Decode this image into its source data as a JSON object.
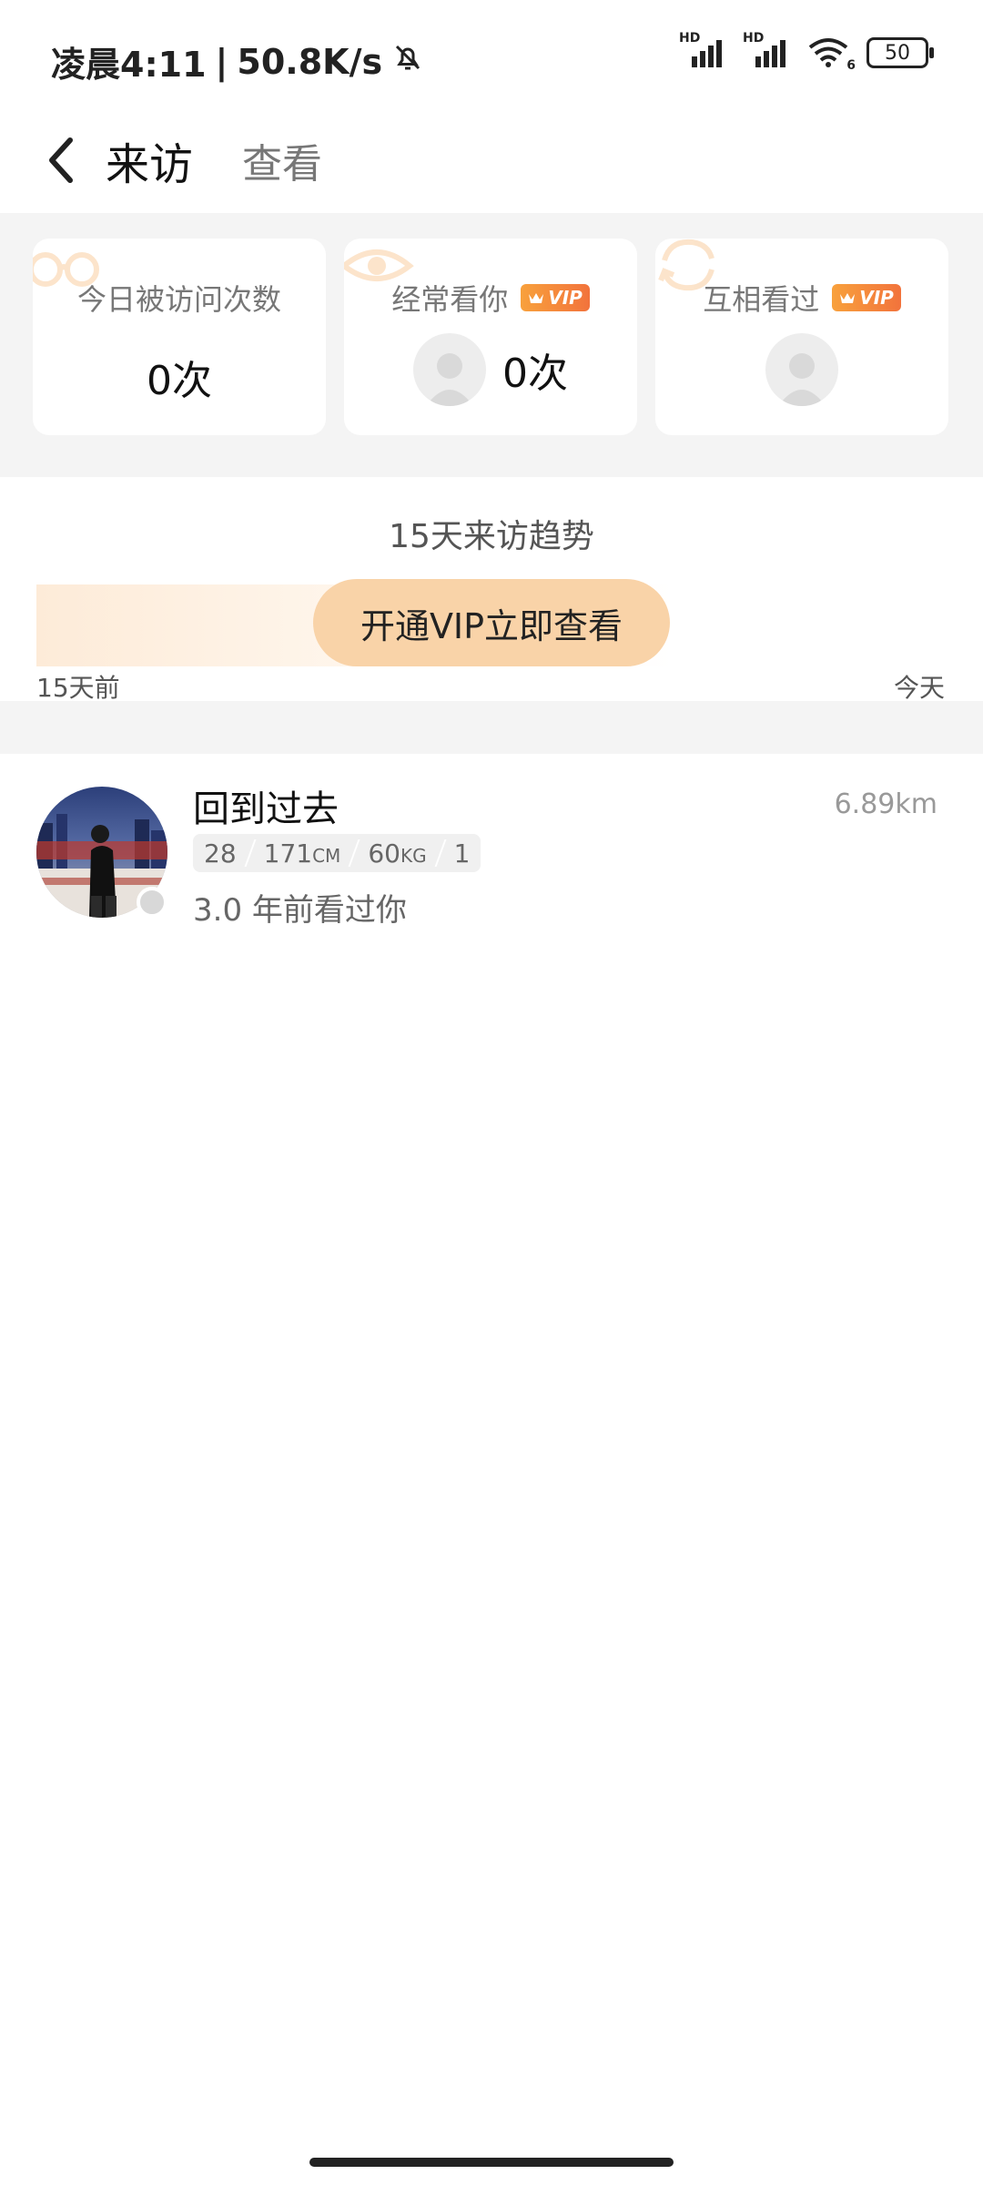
{
  "status_bar": {
    "time": "凌晨4:11",
    "network_speed": "50.8K/s",
    "signal_1_label": "HD",
    "signal_2_label": "HD",
    "wifi_label": "6",
    "battery": "50"
  },
  "header": {
    "title": "来访",
    "action": "查看"
  },
  "stats": {
    "today_visits": {
      "title": "今日被访问次数",
      "value": "0次"
    },
    "often_views": {
      "title": "经常看你",
      "badge": "VIP",
      "value": "0次"
    },
    "mutual_views": {
      "title": "互相看过",
      "badge": "VIP"
    }
  },
  "trend": {
    "title": "15天来访趋势",
    "cta": "开通VIP立即查看",
    "start_label": "15天前",
    "end_label": "今天"
  },
  "visitors": [
    {
      "name": "回到过去",
      "distance": "6.89km",
      "age": "28",
      "height_value": "171",
      "height_unit": "CM",
      "weight_value": "60",
      "weight_unit": "KG",
      "role": "1",
      "time_text": "3.0 年前看过你"
    }
  ],
  "colors": {
    "vip_gradient_start": "#f8a13c",
    "vip_gradient_end": "#f2733c",
    "cta_background": "#f9d3a8",
    "section_background": "#f4f4f4"
  }
}
